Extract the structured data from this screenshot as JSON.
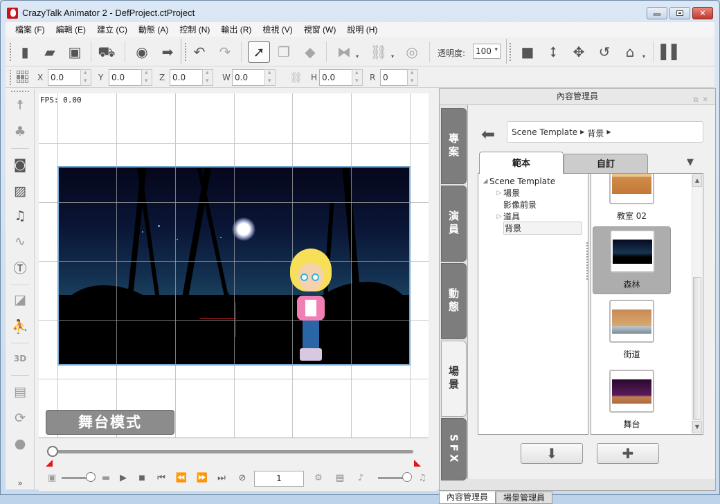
{
  "window": {
    "title": "CrazyTalk Animator 2 - DefProject.ctProject",
    "controls": [
      "minimize",
      "maximize",
      "close"
    ]
  },
  "menubar": [
    "檔案 (F)",
    "編輯 (E)",
    "建立 (C)",
    "動態 (A)",
    "控制 (N)",
    "輸出 (R)",
    "檢視 (V)",
    "視窗 (W)",
    "說明 (H)"
  ],
  "toolbar": {
    "icons": [
      "new-file-icon",
      "open-folder-icon",
      "save-icon",
      "shop-cart-icon",
      "preview-icon",
      "export-icon",
      "undo-icon",
      "redo-icon",
      "select-arrow-icon",
      "clone-icon",
      "layer-icon",
      "flip-icon",
      "link-icon",
      "visibility-eye-icon",
      "camera-icon",
      "move-up-down-icon",
      "move-icon",
      "rotate-icon",
      "home-icon",
      "timeline-icon"
    ],
    "opacity_label": "透明度:",
    "opacity_value": "100"
  },
  "transform": {
    "fields": [
      {
        "label": "X",
        "value": "0.0"
      },
      {
        "label": "Y",
        "value": "0.0"
      },
      {
        "label": "Z",
        "value": "0.0"
      },
      {
        "label": "W",
        "value": "0.0"
      },
      {
        "label": "H",
        "value": "0.0"
      },
      {
        "label": "R",
        "value": "0"
      }
    ]
  },
  "left_toolbar": {
    "icons": [
      "actor-select-icon",
      "prop-tree-icon",
      "face-portrait-icon",
      "image-media-icon",
      "music-note-icon",
      "audio-wave-icon",
      "text-bubble-icon",
      "layer-order-icon",
      "character-frame-icon",
      "3d-icon",
      "script-icon",
      "transform-icon",
      "ball-motion-icon"
    ],
    "more_label": "»"
  },
  "stage": {
    "fps_label": "FPS: 0.00",
    "mode_button": "舞台模式"
  },
  "timeline": {
    "position_fraction": 0,
    "speed_fraction": 1,
    "frame_value": "1",
    "controls": [
      "play",
      "stop",
      "first-frame",
      "previous-frame",
      "next-frame",
      "last-frame",
      "loop"
    ]
  },
  "content_manager": {
    "title": "內容管理員",
    "side_tabs": [
      {
        "label": "專案",
        "active": false
      },
      {
        "label": "演員",
        "active": false
      },
      {
        "label": "動態",
        "active": false
      },
      {
        "label": "場景",
        "active": true
      },
      {
        "label": "SFX",
        "active": false
      }
    ],
    "breadcrumb": [
      "Scene Template",
      "背景"
    ],
    "tabs": [
      {
        "label": "範本",
        "active": true
      },
      {
        "label": "自訂",
        "active": false
      }
    ],
    "tree": [
      {
        "label": "Scene Template",
        "level": 0,
        "expanded": true
      },
      {
        "label": "場景",
        "level": 1,
        "expandable": true
      },
      {
        "label": "影像前景",
        "level": 1,
        "expandable": false
      },
      {
        "label": "道具",
        "level": 1,
        "expandable": true
      },
      {
        "label": "背景",
        "level": 1,
        "expandable": false,
        "selected": true
      }
    ],
    "thumbnails": [
      {
        "label": "教室 02",
        "selected": false
      },
      {
        "label": "森林",
        "selected": true
      },
      {
        "label": "街道",
        "selected": false
      },
      {
        "label": "舞台",
        "selected": false
      }
    ],
    "actions": [
      "apply-down-icon",
      "add-plus-icon"
    ]
  },
  "bottom_tabs": [
    {
      "label": "內容管理員",
      "active": true
    },
    {
      "label": "場景管理員",
      "active": false
    }
  ]
}
